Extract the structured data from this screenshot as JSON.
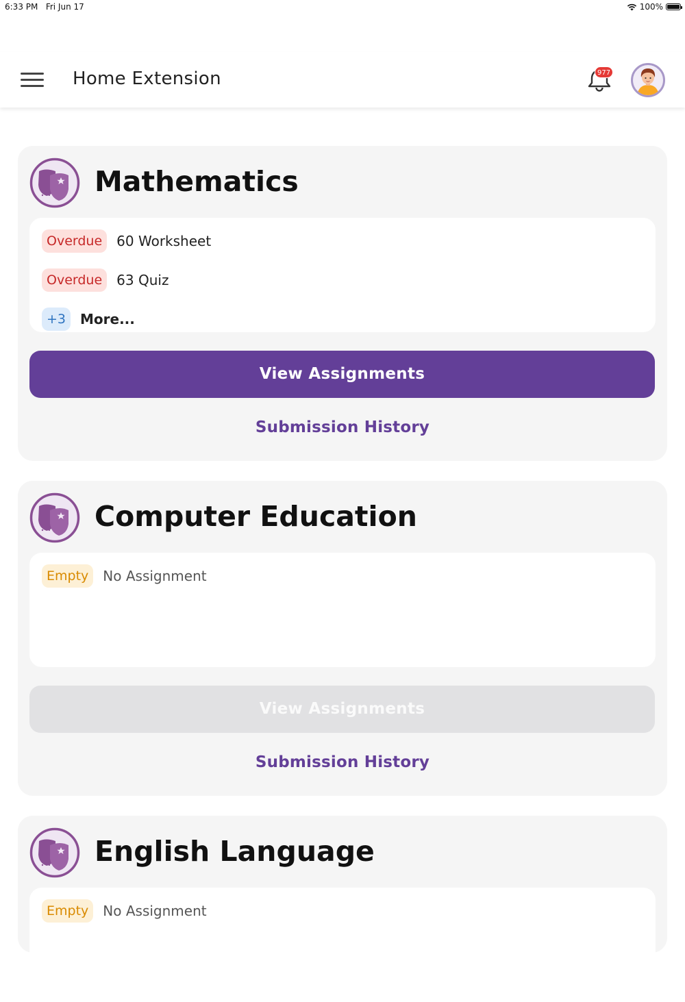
{
  "status_bar": {
    "time": "6:33 PM",
    "date": "Fri Jun 17",
    "battery": "100%",
    "battery_level": 1.0
  },
  "header": {
    "menu_icon": "hamburger-menu-icon",
    "title": "Home Extension",
    "notification_icon": "bell-icon",
    "notification_count": "977",
    "avatar_icon": "student-avatar-icon"
  },
  "colors": {
    "primary": "#633f98",
    "overdue_text": "#c62828",
    "overdue_bg": "#fde0dd",
    "empty_text": "#d98a00",
    "empty_bg": "#fdf0d6",
    "more_text": "#2f74c0",
    "more_bg": "#dcebfb",
    "badge": "#e53935"
  },
  "subjects": [
    {
      "name": "Mathematics",
      "icon": "theater-masks-icon",
      "items": [
        {
          "status": "Overdue",
          "label": "60 Worksheet"
        },
        {
          "status": "Overdue",
          "label": "63 Quiz"
        }
      ],
      "more": {
        "count": "+3",
        "label": "More..."
      },
      "view_button": "View Assignments",
      "view_enabled": true,
      "history_link": "Submission History"
    },
    {
      "name": "Computer Education",
      "icon": "theater-masks-icon",
      "items": [
        {
          "status": "Empty",
          "label": "No Assignment"
        }
      ],
      "view_button": "View Assignments",
      "view_enabled": false,
      "history_link": "Submission History"
    },
    {
      "name": "English Language",
      "icon": "theater-masks-icon",
      "items": [
        {
          "status": "Empty",
          "label": "No Assignment"
        }
      ]
    }
  ]
}
